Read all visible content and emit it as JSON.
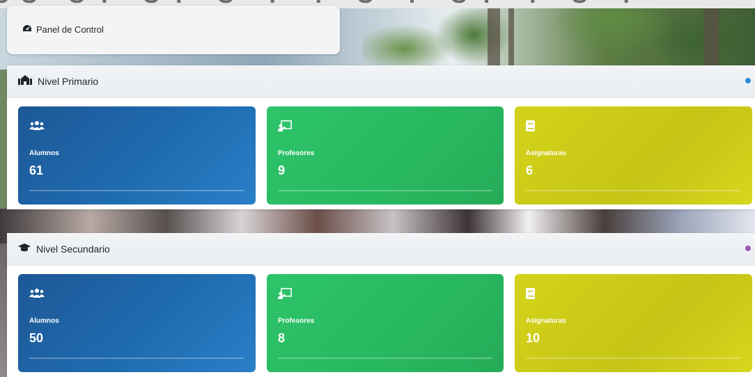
{
  "header": {
    "title": "Panel de Control",
    "icon": "tachometer-icon"
  },
  "levels": [
    {
      "title": "Nivel Primario",
      "icon": "school-icon",
      "dot_color": "#2a8ad8",
      "cards": [
        {
          "label": "Alumnos",
          "value": "61",
          "icon": "users-icon",
          "color": "#1f6bb0"
        },
        {
          "label": "Profesores",
          "value": "9",
          "icon": "chalkboard-teacher-icon",
          "color": "#28b85f"
        },
        {
          "label": "Asignaturas",
          "value": "6",
          "icon": "book-icon",
          "color": "#c6c416"
        }
      ]
    },
    {
      "title": "Nivel Secundario",
      "icon": "graduation-cap-icon",
      "dot_color": "#9b59b6",
      "cards": [
        {
          "label": "Alumnos",
          "value": "50",
          "icon": "users-icon",
          "color": "#1f6bb0"
        },
        {
          "label": "Profesores",
          "value": "8",
          "icon": "chalkboard-teacher-icon",
          "color": "#28b85f"
        },
        {
          "label": "Asignaturas",
          "value": "10",
          "icon": "book-icon",
          "color": "#c6c416"
        }
      ]
    }
  ]
}
